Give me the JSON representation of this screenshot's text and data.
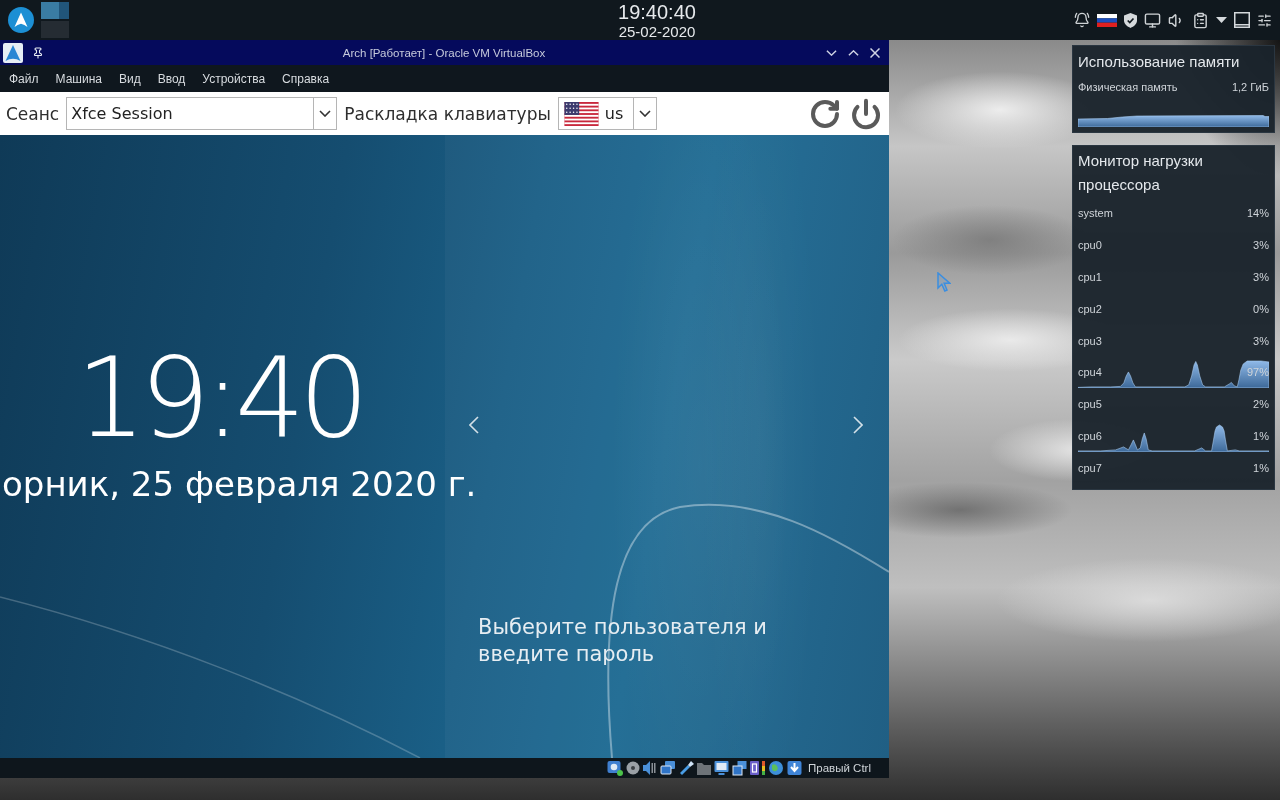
{
  "top_panel": {
    "pager": {
      "desktops": [
        {
          "selected": true
        },
        {
          "selected": false
        }
      ]
    },
    "clock": {
      "time": "19:40:40",
      "date": "25-02-2020"
    }
  },
  "vm_window": {
    "title": "Arch [Работает] - Oracle VM VirtualBox",
    "menu": [
      "Файл",
      "Машина",
      "Вид",
      "Ввод",
      "Устройства",
      "Справка"
    ],
    "login_screen": {
      "session_label": "Сеанс",
      "session": "Xfce Session",
      "layout_label": "Раскладка клавиатуры",
      "layout": "us",
      "time": "19:40",
      "date": "орник, 25 февраля 2020 г.",
      "prompt": "Выберите пользователя и введите пароль"
    },
    "status_bar": {
      "host_key": "Правый Ctrl"
    }
  },
  "widgets": {
    "memory": {
      "title": "Использование памяти",
      "label": "Физическая память",
      "reading": "1,2 ГиБ"
    },
    "cpu": {
      "title": "Монитор нагрузки процессора",
      "rows": [
        {
          "name": "system",
          "reading": "14%",
          "kind": "plain"
        },
        {
          "name": "cpu0",
          "reading": "3%",
          "kind": "plain"
        },
        {
          "name": "cpu1",
          "reading": "3%",
          "kind": "plain"
        },
        {
          "name": "cpu2",
          "reading": "0%",
          "kind": "plain"
        },
        {
          "name": "cpu3",
          "reading": "3%",
          "kind": "plain"
        },
        {
          "name": "cpu4",
          "reading": "97%",
          "kind": "graph"
        },
        {
          "name": "cpu5",
          "reading": "2%",
          "kind": "plain"
        },
        {
          "name": "cpu6",
          "reading": "1%",
          "kind": "graph"
        },
        {
          "name": "cpu7",
          "reading": "1%",
          "kind": "plain"
        }
      ]
    }
  }
}
